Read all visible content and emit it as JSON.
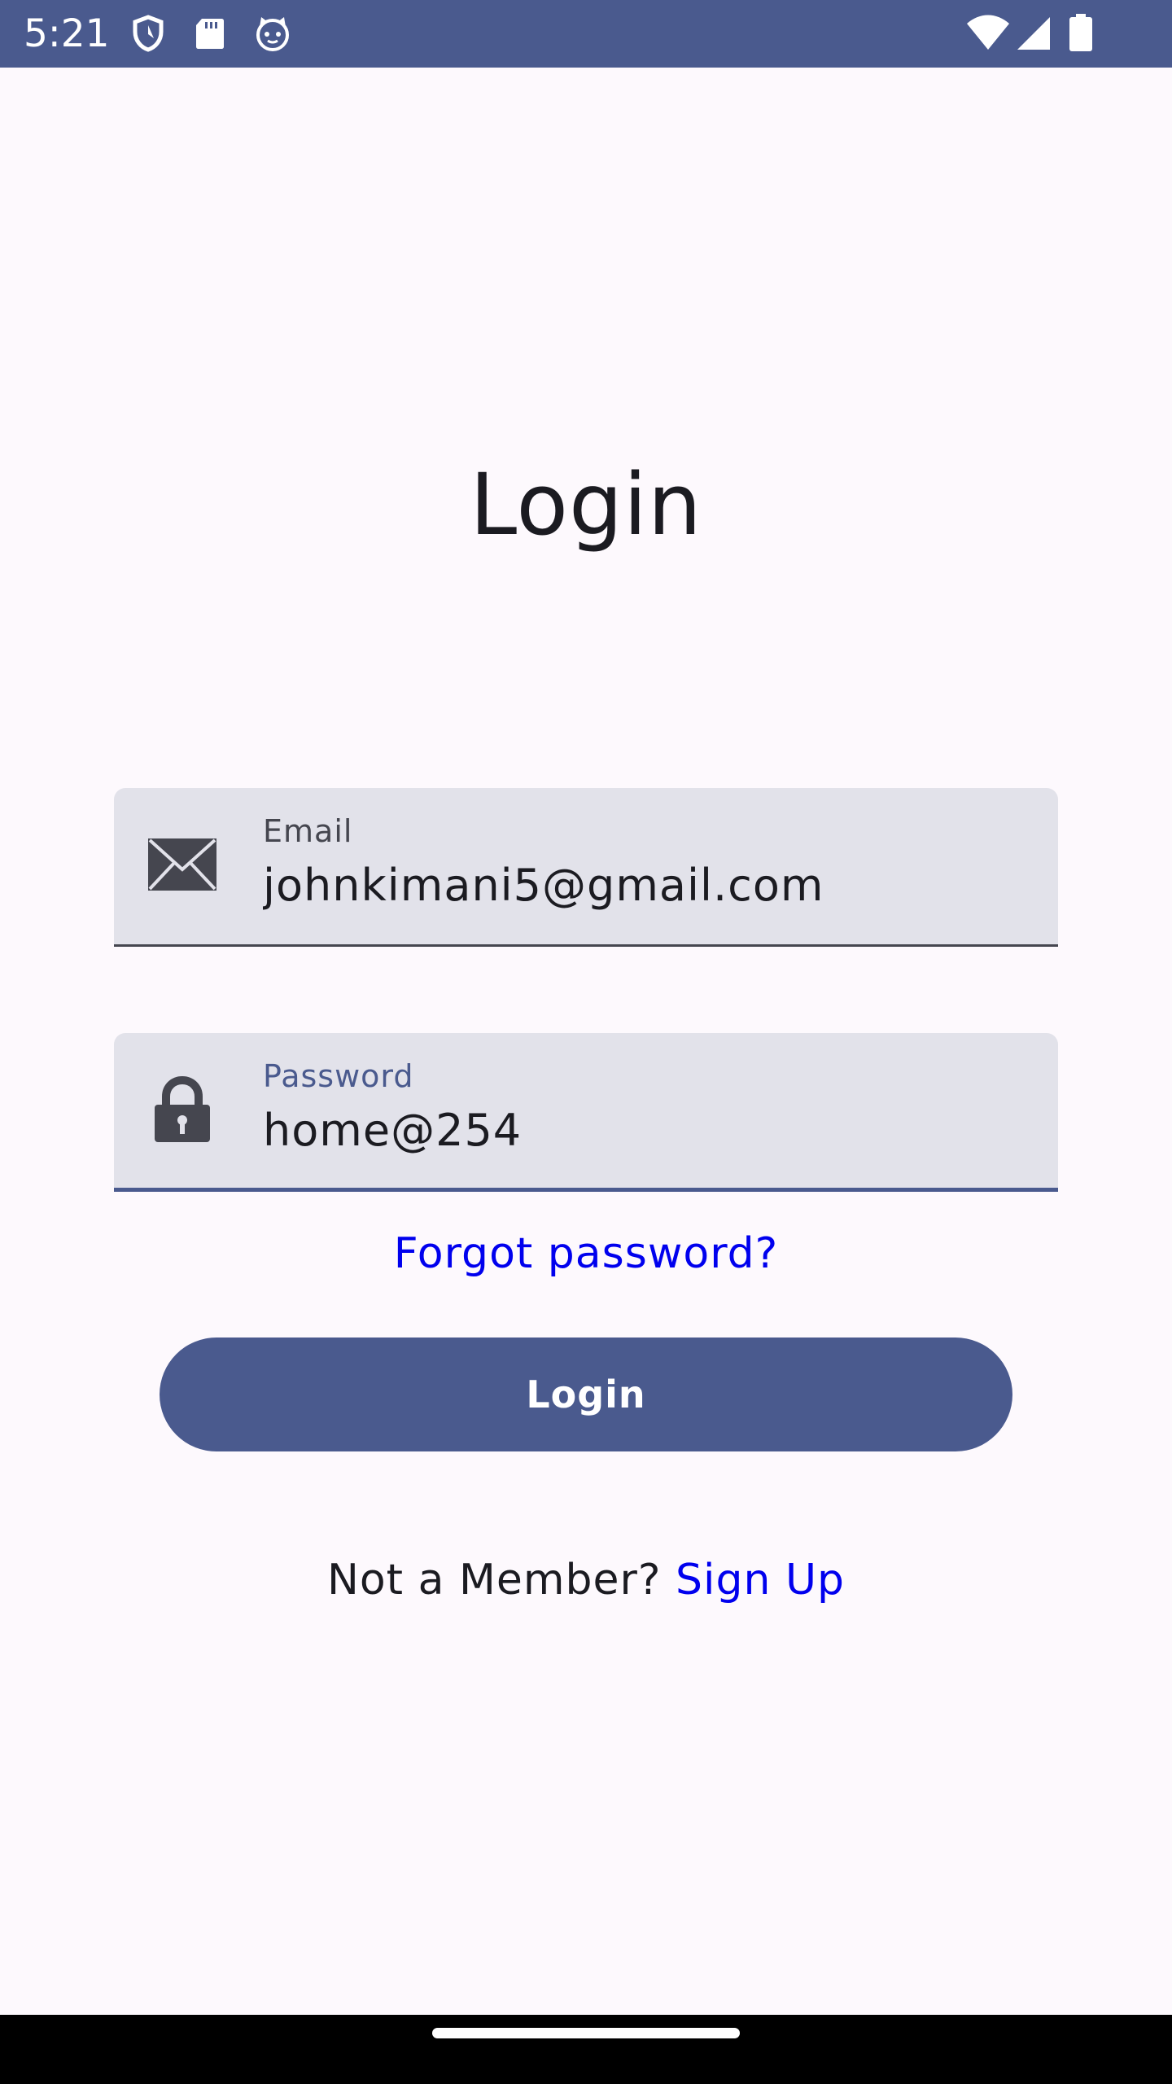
{
  "status_bar": {
    "time": "5:21",
    "left_icons": [
      "shield-icon",
      "sd-card-icon",
      "cat-face-icon"
    ],
    "right_icons": [
      "wifi-icon",
      "cellular-signal-icon",
      "battery-icon"
    ]
  },
  "login": {
    "title": "Login",
    "email": {
      "label": "Email",
      "value": "johnkimani5@gmail.com",
      "icon": "envelope-icon"
    },
    "password": {
      "label": "Password",
      "value": "home@254",
      "icon": "lock-icon"
    },
    "forgot_password": "Forgot password?",
    "login_button": "Login",
    "signup_prompt": "Not a Member?",
    "signup_link": "Sign Up"
  },
  "colors": {
    "primary": "#4A5A8E",
    "background": "#FDF9FD",
    "field_fill": "#E2E2EA",
    "link": "#0000EE",
    "text": "#1B1B21"
  }
}
